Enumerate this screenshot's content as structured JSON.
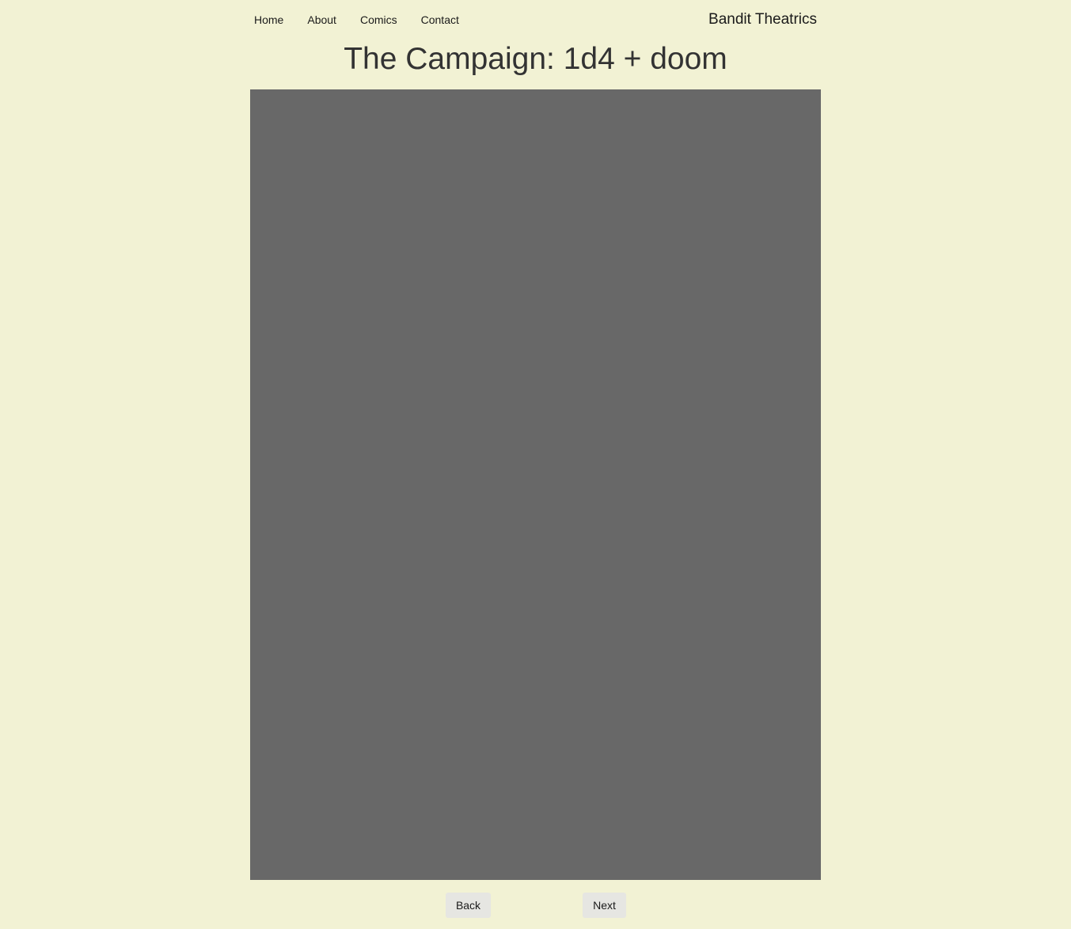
{
  "nav": {
    "links": [
      "Home",
      "About",
      "Comics",
      "Contact"
    ],
    "brand": "Bandit Theatrics"
  },
  "page": {
    "title": "The Campaign: 1d4 + doom"
  },
  "pager": {
    "back_label": "Back",
    "next_label": "Next"
  },
  "colors": {
    "background": "#f2f2d4",
    "image_placeholder": "#686868",
    "button_bg": "#e6e6e2"
  }
}
